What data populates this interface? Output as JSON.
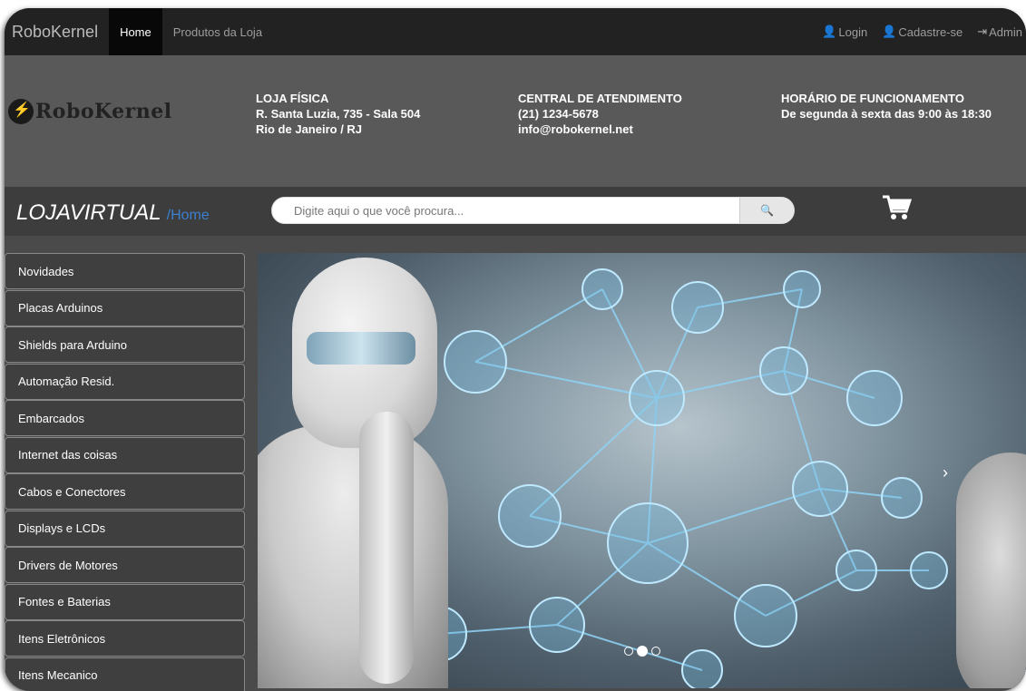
{
  "navbar": {
    "brand": "RoboKernel",
    "links": [
      "Home",
      "Produtos da Loja"
    ],
    "login": "Login",
    "signup": "Cadastre-se",
    "admin": "Admin"
  },
  "header": {
    "logo_text": "RoboKernel",
    "store": {
      "title": "LOJA FÍSICA",
      "line1": "R. Santa Luzia, 735 - Sala 504",
      "line2": "Rio de Janeiro / RJ"
    },
    "support": {
      "title": "CENTRAL DE ATENDIMENTO",
      "line1": "(21) 1234-5678",
      "line2": "info@robokernel.net"
    },
    "hours": {
      "title": "HORÁRIO DE FUNCIONAMENTO",
      "line1": "De segunda à sexta das 9:00 às 18:30"
    }
  },
  "searchbar": {
    "title": "LOJAVIRTUAL",
    "crumb": "/Home",
    "placeholder": "Digite aqui o que você procura..."
  },
  "sidebar": {
    "categories": [
      "Novidades",
      "Placas Arduinos",
      "Shields para Arduino",
      "Automação Resid.",
      "Embarcados",
      "Internet das coisas",
      "Cabos e Conectores",
      "Displays e LCDs",
      "Drivers de Motores",
      "Fontes e Baterias",
      "Itens Eletrônicos",
      "Itens Mecanico"
    ]
  },
  "carousel": {
    "slides": 3,
    "active_slide": 2
  },
  "colors": {
    "navbar": "#222222",
    "header": "#595959",
    "accent": "#3d7fd0"
  }
}
